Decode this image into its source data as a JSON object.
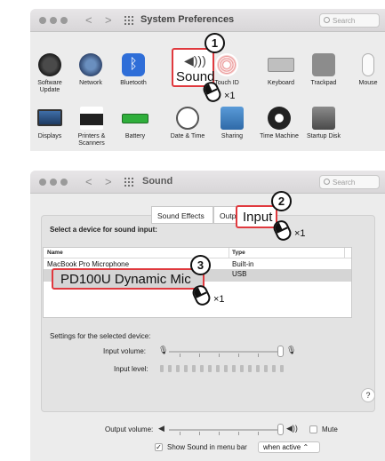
{
  "window1": {
    "title": "System Preferences",
    "search_placeholder": "Search",
    "nav_back": "<",
    "nav_forward": ">",
    "panes_row1": [
      "Software Update",
      "Network",
      "Bluetooth",
      "Sound",
      "Touch ID",
      "Keyboard",
      "Trackpad",
      "Mouse"
    ],
    "panes_row2": [
      "Displays",
      "Printers & Scanners",
      "Battery",
      "Date & Time",
      "Sharing",
      "Time Machine",
      "Startup Disk"
    ],
    "sound_callout": "Sound",
    "step_number": "1",
    "click_count": "×1"
  },
  "window2": {
    "title": "Sound",
    "search_placeholder": "Search",
    "nav_back": "<",
    "nav_forward": ">",
    "tabs": {
      "sound_effects": "Sound Effects",
      "output_partial": "Outp",
      "input": "Input"
    },
    "step2_number": "2",
    "step2_count": "×1",
    "select_device_heading": "Select a device for sound input:",
    "columns": {
      "name": "Name",
      "type": "Type"
    },
    "devices": [
      {
        "name": "MacBook Pro Microphone",
        "type": "Built-in"
      },
      {
        "name": "PD100U Dynamic Mic",
        "type": "USB"
      }
    ],
    "step3_number": "3",
    "step3_count": "×1",
    "settings_heading": "Settings for the selected device:",
    "input_volume_label": "Input volume:",
    "input_level_label": "Input level:",
    "help": "?",
    "output_volume_label": "Output volume:",
    "mute_label": "Mute",
    "show_sound_label": "Show Sound in menu bar",
    "show_sound_checked": "✓",
    "show_sound_option": "when active ⌃"
  }
}
